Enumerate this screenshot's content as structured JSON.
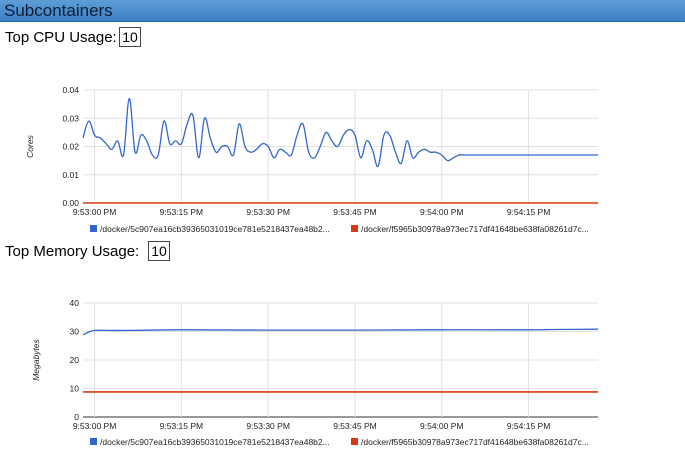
{
  "section": {
    "title": "Subcontainers"
  },
  "cpu_control": {
    "label": "Top CPU Usage:",
    "value": "10"
  },
  "memory_control": {
    "label": "Top Memory Usage:",
    "value": "10"
  },
  "colors": {
    "series_blue": "#3366cc",
    "series_red": "#dc3912",
    "grid": "#e0e0e0",
    "header": "#4a8fd0"
  },
  "chart_data": [
    {
      "type": "line",
      "title": "",
      "ylabel": "Cores",
      "xlabel": "",
      "ylim": [
        0,
        0.04
      ],
      "yticks": [
        "0.00",
        "0.01",
        "0.02",
        "0.03",
        "0.04"
      ],
      "xticks": [
        "9:53:00 PM",
        "9:53:15 PM",
        "9:53:30 PM",
        "9:53:45 PM",
        "9:54:00 PM",
        "9:54:15 PM"
      ],
      "x_range_seconds": [
        -2,
        87
      ],
      "legend_position": "bottom",
      "series": [
        {
          "name": "/docker/5c907ea16cb39365031019ce781e5218437ea48b2...",
          "color": "#3366cc",
          "x": [
            -2,
            -1,
            0,
            1,
            2,
            3,
            4,
            5,
            6,
            7,
            8,
            9,
            10,
            11,
            12,
            13,
            14,
            15,
            16,
            17,
            18,
            19,
            20,
            21,
            22,
            23,
            24,
            25,
            26,
            27,
            28,
            29,
            30,
            31,
            32,
            33,
            34,
            35,
            36,
            37,
            38,
            39,
            40,
            41,
            42,
            43,
            44,
            45,
            46,
            47,
            48,
            49,
            50,
            51,
            52,
            53,
            54,
            55,
            56,
            57,
            58,
            59,
            60,
            61,
            62,
            63,
            64,
            65,
            66,
            67,
            68,
            69,
            70,
            71,
            72,
            73,
            74,
            75,
            76,
            77,
            78,
            79,
            80,
            81,
            82,
            83,
            84,
            85,
            86,
            87
          ],
          "values": [
            0.023,
            0.029,
            0.024,
            0.023,
            0.021,
            0.019,
            0.022,
            0.017,
            0.037,
            0.018,
            0.024,
            0.022,
            0.017,
            0.017,
            0.029,
            0.021,
            0.022,
            0.021,
            0.028,
            0.031,
            0.016,
            0.03,
            0.023,
            0.018,
            0.02,
            0.02,
            0.017,
            0.028,
            0.02,
            0.018,
            0.019,
            0.021,
            0.02,
            0.016,
            0.019,
            0.018,
            0.017,
            0.024,
            0.028,
            0.018,
            0.016,
            0.02,
            0.025,
            0.022,
            0.02,
            0.024,
            0.026,
            0.024,
            0.016,
            0.022,
            0.019,
            0.013,
            0.024,
            0.024,
            0.018,
            0.014,
            0.022,
            0.016,
            0.018,
            0.019,
            0.018,
            0.018,
            0.017,
            0.015,
            0.016,
            0.017,
            0.017,
            0.017,
            0.017,
            0.017,
            0.017,
            0.017,
            0.017,
            0.017,
            0.017,
            0.017,
            0.017,
            0.017,
            0.017,
            0.017,
            0.017,
            0.017,
            0.017,
            0.017,
            0.017,
            0.017,
            0.017,
            0.017,
            0.017,
            0.017
          ]
        },
        {
          "name": "/docker/f5965b30978a973ec717df41648be638fa08261d7c...",
          "color": "#dc3912",
          "x": [
            -2,
            87
          ],
          "values": [
            0.0,
            0.0
          ]
        }
      ]
    },
    {
      "type": "line",
      "title": "",
      "ylabel": "Megabytes",
      "xlabel": "",
      "ylim": [
        0,
        40
      ],
      "yticks": [
        "0",
        "10",
        "20",
        "30",
        "40"
      ],
      "xticks": [
        "9:53:00 PM",
        "9:53:15 PM",
        "9:53:30 PM",
        "9:53:45 PM",
        "9:54:00 PM",
        "9:54:15 PM"
      ],
      "x_range_seconds": [
        -2,
        87
      ],
      "legend_position": "bottom",
      "series": [
        {
          "name": "/docker/5c907ea16cb39365031019ce781e5218437ea48b2...",
          "color": "#3366cc",
          "x": [
            -2,
            -1,
            0,
            2,
            6,
            15,
            30,
            45,
            60,
            75,
            80,
            87
          ],
          "values": [
            28.8,
            29.8,
            30.4,
            30.4,
            30.4,
            30.6,
            30.5,
            30.5,
            30.6,
            30.6,
            30.7,
            30.8
          ]
        },
        {
          "name": "/docker/f5965b30978a973ec717df41648be638fa08261d7c...",
          "color": "#dc3912",
          "x": [
            -2,
            87
          ],
          "values": [
            8.8,
            8.8
          ]
        }
      ]
    }
  ]
}
